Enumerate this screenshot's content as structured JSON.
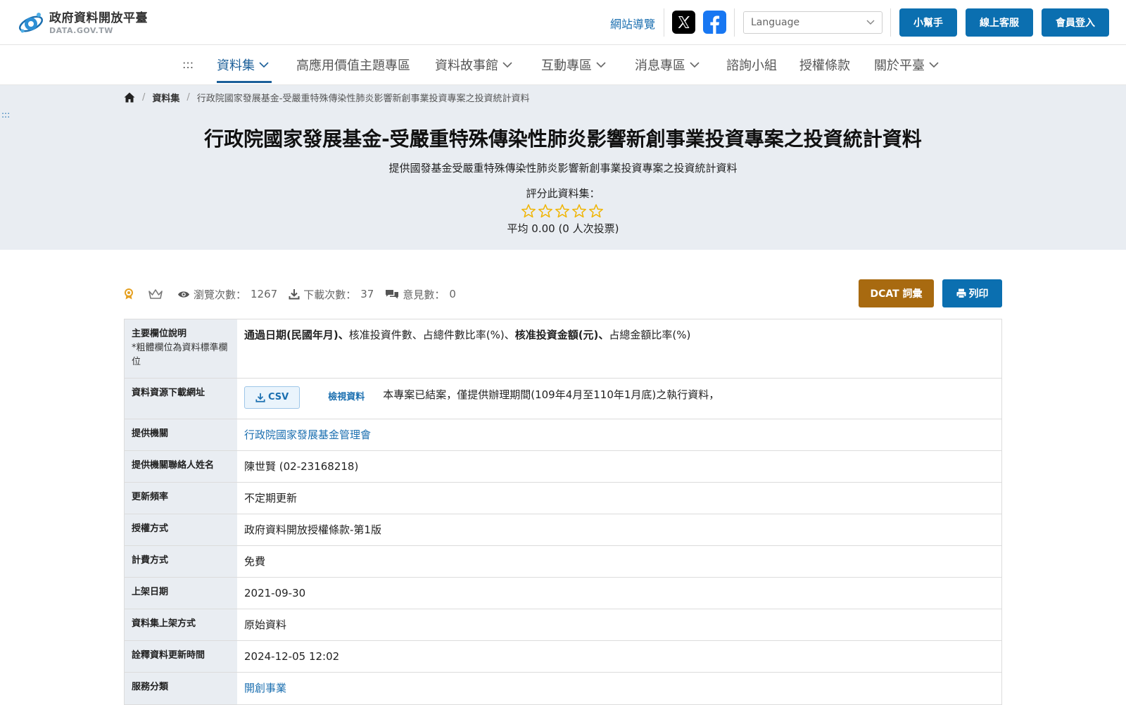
{
  "header": {
    "logo_title": "政府資料開放平臺",
    "logo_sub": "DATA.GOV.TW",
    "sitemap": "網站導覽",
    "language_placeholder": "Language",
    "buttons": {
      "helper": "小幫手",
      "support": "線上客服",
      "login": "會員登入"
    }
  },
  "nav": {
    "accesskey": ":::",
    "items": [
      "資料集",
      "高應用價值主題專區",
      "資料故事館",
      "互動專區",
      "消息專區",
      "諮詢小組",
      "授權條款",
      "關於平臺"
    ]
  },
  "breadcrumb": {
    "level1": "資料集",
    "current": "行政院國家發展基金-受嚴重特殊傳染性肺炎影響新創事業投資專案之投資統計資料"
  },
  "hero": {
    "accesskey": ":::",
    "title": "行政院國家發展基金-受嚴重特殊傳染性肺炎影響新創事業投資專案之投資統計資料",
    "description": "提供國發基金受嚴重特殊傳染性肺炎影響新創事業投資專案之投資統計資料",
    "rate_label": "評分此資料集：",
    "rating": 0,
    "rating_max": 5,
    "average": "平均 0.00 (0 人次投票)"
  },
  "stats": {
    "views_label": "瀏覽次數：",
    "views": "1267",
    "downloads_label": "下載次數：",
    "downloads": "37",
    "comments_label": "意見數：",
    "comments": "0"
  },
  "actions": {
    "dcat": "DCAT 詞彙",
    "print": "列印"
  },
  "table": {
    "fields": {
      "label": "主要欄位說明",
      "note": "*粗體欄位為資料標準欄位",
      "parts": [
        "通過日期(民國年月)、",
        "核准投資件數、占總件數比率(%)、",
        "核准投資金額(元)、",
        "占總金額比率(%)"
      ]
    },
    "download": {
      "label": "資料資源下載網址",
      "csv": "CSV",
      "view": "檢視資料",
      "note": "本專案已結案，僅提供辦理期間(109年4月至110年1月底)之執行資料，"
    },
    "provider": {
      "label": "提供機關",
      "value": "行政院國家發展基金管理會"
    },
    "contact": {
      "label": "提供機關聯絡人姓名",
      "value": "陳世賢 (02-23168218)"
    },
    "frequency": {
      "label": "更新頻率",
      "value": "不定期更新"
    },
    "license": {
      "label": "授權方式",
      "value": "政府資料開放授權條款-第1版"
    },
    "fee": {
      "label": "計費方式",
      "value": "免費"
    },
    "published": {
      "label": "上架日期",
      "value": "2021-09-30"
    },
    "method": {
      "label": "資料集上架方式",
      "value": "原始資料"
    },
    "meta_updated": {
      "label": "詮釋資料更新時間",
      "value": "2024-12-05 12:02"
    },
    "category": {
      "label": "服務分類",
      "value": "開創事業"
    }
  },
  "colors": {
    "primary": "#0b6fb0",
    "dcat": "#a86a10",
    "hero_bg": "#e9edf2",
    "star": "#f0b400"
  }
}
